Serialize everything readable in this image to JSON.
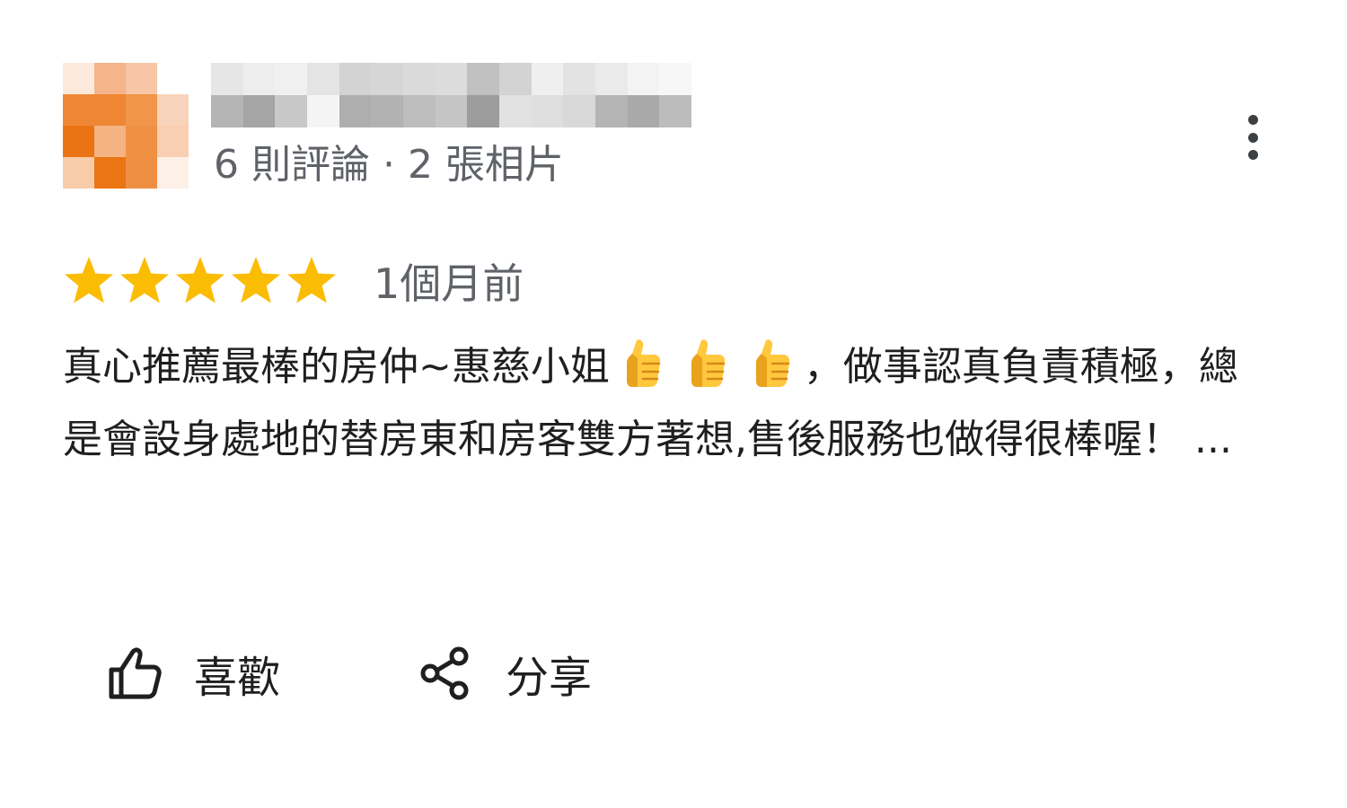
{
  "reviewer": {
    "meta": "6 則評論 · 2 張相片",
    "more_icon": "more-vert-icon",
    "avatar_colors": [
      "#fde9dc",
      "#f5b489",
      "#f6c6a6",
      "#ffffff",
      "#ef8633",
      "#ef8633",
      "#f0954a",
      "#f8d3bb",
      "#ea7413",
      "#f5b283",
      "#f09043",
      "#f8cfb3",
      "#f8cba9",
      "#ea7512",
      "#ef8f43",
      "#fdf0e7"
    ],
    "name_blur_colors": [
      "#e6e6e6",
      "#ededed",
      "#f0f0f0",
      "#e4e4e4",
      "#d3d3d3",
      "#d6d6d6",
      "#dadada",
      "#dcdcdc",
      "#c0c0c0",
      "#d3d3d3",
      "#efefef",
      "#e3e3e3",
      "#eaeaea",
      "#f3f3f3",
      "#f7f7f7",
      "#b4b4b4",
      "#a5a5a5",
      "#c8c8c8",
      "#f4f4f4",
      "#aeaeae",
      "#b2b2b2",
      "#bdbdbd",
      "#c5c5c5",
      "#9c9c9c",
      "#e1e1e1",
      "#dedede",
      "#d8d8d8",
      "#b4b4b4",
      "#a9a9a9",
      "#bcbcbc"
    ]
  },
  "rating": {
    "stars": 5,
    "max": 5,
    "star_color": "#fbbc04",
    "time": "1個月前"
  },
  "review": {
    "part1": "真心推薦最棒的房仲~惠慈小姐",
    "emoji": "thumbs-up-emoji",
    "emoji_count": 3,
    "part2": "，做事認真負責積極，總是會設身處地的替房東和房客雙方著想,售後服務也做得很棒喔！ ..."
  },
  "actions": {
    "like_label": "喜歡",
    "like_icon": "thumb-up-outline-icon",
    "share_label": "分享",
    "share_icon": "share-icon"
  }
}
